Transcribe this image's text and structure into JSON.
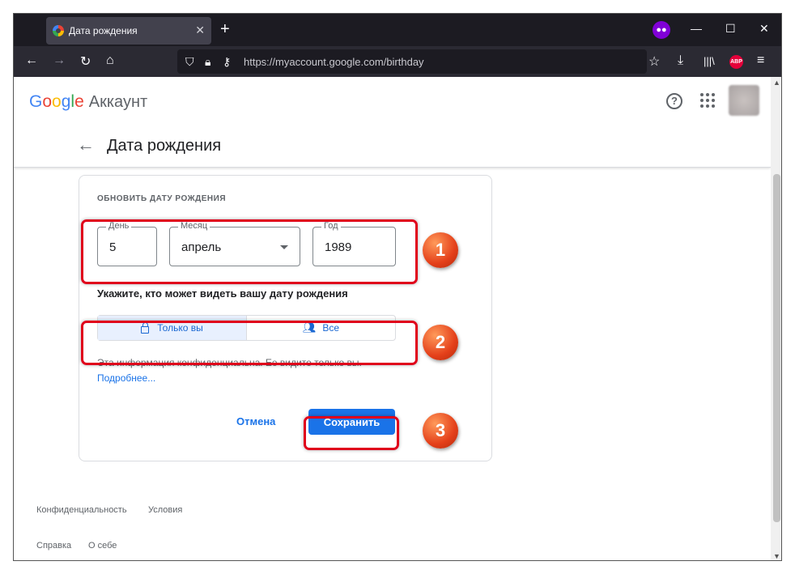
{
  "browser": {
    "tab_title": "Дата рождения",
    "tab_close": "✕",
    "new_tab": "+",
    "url": "https://myaccount.google.com/birthday",
    "abp_label": "ABP",
    "window_controls": {
      "minimize": "—",
      "maximize": "☐",
      "close": "✕"
    }
  },
  "header": {
    "logo_letters": [
      "G",
      "o",
      "o",
      "g",
      "l",
      "e"
    ],
    "product": "Аккаунт",
    "help_label": "?"
  },
  "page": {
    "title": "Дата рождения",
    "section_title": "ОБНОВИТЬ ДАТУ РОЖДЕНИЯ",
    "day": {
      "label": "День",
      "value": "5"
    },
    "month": {
      "label": "Месяц",
      "value": "апрель"
    },
    "year": {
      "label": "Год",
      "value": "1989"
    },
    "visibility_question": "Укажите, кто может видеть вашу дату рождения",
    "visibility_options": [
      {
        "label": "Только вы",
        "icon": "lock-icon",
        "selected": true
      },
      {
        "label": "Все",
        "icon": "people-icon",
        "selected": false
      }
    ],
    "info_text": "Эта информация конфиденциальна. Ее видите только вы.",
    "learn_more": "Подробнее...",
    "cancel_label": "Отмена",
    "save_label": "Сохранить"
  },
  "annotations": {
    "step1": "1",
    "step2": "2",
    "step3": "3"
  },
  "footer": {
    "privacy": "Конфиденциальность",
    "terms": "Условия",
    "help": "Справка",
    "about": "О себе"
  },
  "colors": {
    "accent": "#1a73e8",
    "highlight": "#e0001b"
  }
}
